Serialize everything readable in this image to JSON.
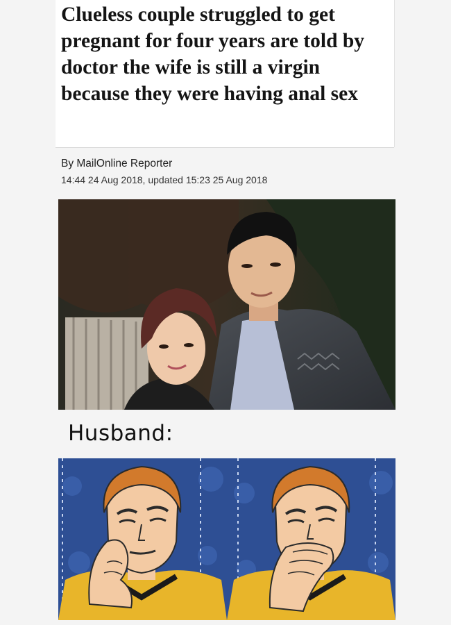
{
  "article": {
    "headline": "Clueless couple struggled to get pregnant for four years are told by doctor the wife is still a virgin because they were having anal sex",
    "byline": "By MailOnline Reporter",
    "timestamp": "14:44 24 Aug 2018, updated 15:23 25 Aug 2018"
  },
  "meme": {
    "label": "Husband:",
    "panels": [
      {
        "pose": "hand-on-cheek"
      },
      {
        "pose": "hand-over-mouth"
      }
    ]
  },
  "colors": {
    "panel_background": "#2e4f94",
    "uniform": "#e8b52a",
    "hair": "#d27a2c",
    "skin": "#f3caa3"
  }
}
